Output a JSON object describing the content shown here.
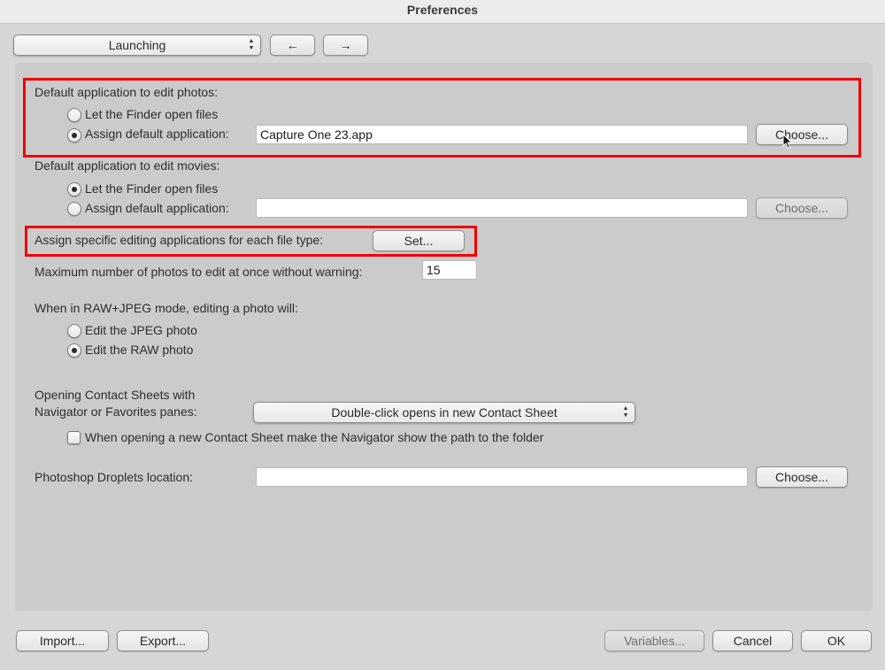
{
  "window": {
    "title": "Preferences"
  },
  "toolbar": {
    "section_popup": "Launching",
    "back_label": "←",
    "forward_label": "→"
  },
  "photos": {
    "heading": "Default application to edit photos:",
    "option_finder": "Let the Finder open files",
    "option_assign": "Assign default application:",
    "selected": "assign",
    "app_value": "Capture One 23.app",
    "choose_label": "Choose..."
  },
  "movies": {
    "heading": "Default application to edit movies:",
    "option_finder": "Let the Finder open files",
    "option_assign": "Assign default application:",
    "selected": "finder",
    "app_value": "",
    "choose_label": "Choose..."
  },
  "file_types": {
    "label": "Assign specific editing applications for each file type:",
    "set_label": "Set..."
  },
  "max_photos": {
    "label": "Maximum number of photos to edit at once without warning:",
    "value": "15"
  },
  "raw_jpeg": {
    "heading": "When in RAW+JPEG mode, editing a photo will:",
    "option_jpeg": "Edit the JPEG photo",
    "option_raw": "Edit the RAW photo",
    "selected": "raw"
  },
  "contact_sheets": {
    "label_line1": "Opening Contact Sheets with",
    "label_line2": "Navigator or Favorites panes:",
    "popup_value": "Double-click opens in new Contact Sheet",
    "checkbox_label": "When opening a new Contact Sheet make the Navigator show the path to the folder",
    "checkbox_checked": false
  },
  "droplets": {
    "label": "Photoshop Droplets location:",
    "value": "",
    "choose_label": "Choose..."
  },
  "footer": {
    "import_label": "Import...",
    "export_label": "Export...",
    "variables_label": "Variables...",
    "cancel_label": "Cancel",
    "ok_label": "OK"
  },
  "annotations": {
    "highlight_color": "#ee0000"
  }
}
